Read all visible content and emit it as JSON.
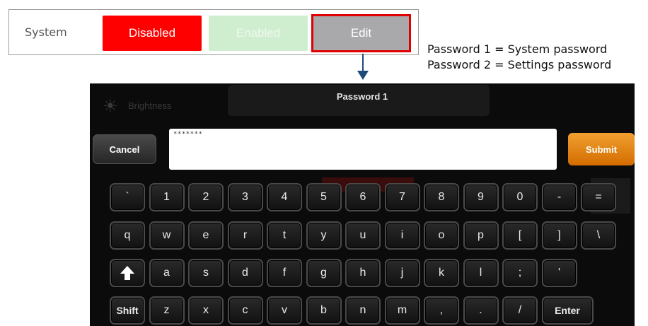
{
  "top": {
    "label": "System",
    "disabled_label": "Disabled",
    "enabled_label": "Enabled",
    "edit_label": "Edit",
    "colors": {
      "disabled": "#ff0000",
      "enabled": "#cfeecf",
      "edit": "#a9a9ab",
      "highlight": "#e00000"
    }
  },
  "note": {
    "line1": "Password 1 = System password",
    "line2": "Password 2 = Settings password"
  },
  "screen": {
    "title": "Password 1",
    "cancel_label": "Cancel",
    "submit_label": "Submit",
    "input_value": "*******",
    "background_label": "Brightness",
    "colors": {
      "submit": "#e07a10",
      "screen_bg": "#0b0b0b"
    }
  },
  "keyboard": {
    "row1": [
      "`",
      "1",
      "2",
      "3",
      "4",
      "5",
      "6",
      "7",
      "8",
      "9",
      "0",
      "-",
      "="
    ],
    "row2": [
      "q",
      "w",
      "e",
      "r",
      "t",
      "y",
      "u",
      "i",
      "o",
      "p",
      "[",
      "]",
      "\\"
    ],
    "row3": [
      "a",
      "s",
      "d",
      "f",
      "g",
      "h",
      "j",
      "k",
      "l",
      ";",
      "'"
    ],
    "row4": [
      "z",
      "x",
      "c",
      "v",
      "b",
      "n",
      "m",
      ",",
      ".",
      "/"
    ],
    "shift_label": "Shift",
    "enter_label": "Enter",
    "caps_icon": "up-arrow-icon"
  }
}
